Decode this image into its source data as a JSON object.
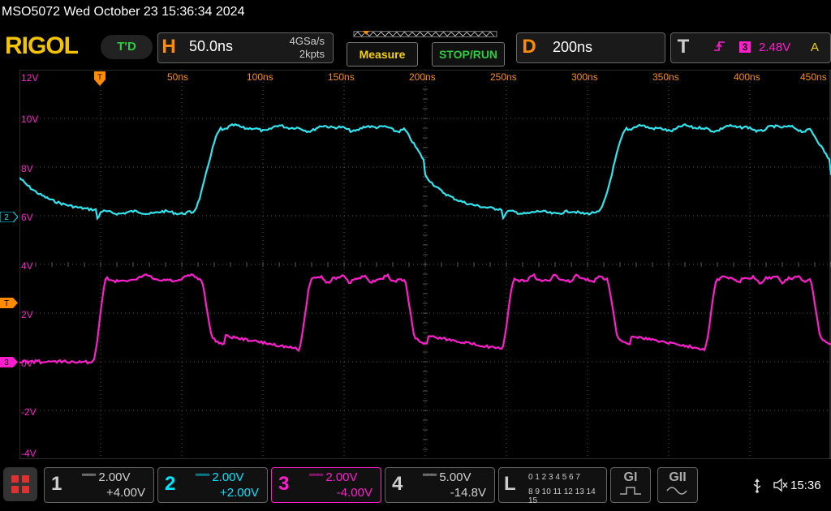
{
  "header": {
    "title": "MSO5072  Wed October 23 15:36:34 2024",
    "logo": "RIGOL",
    "td_badge": "T'D"
  },
  "horizontal": {
    "letter": "H",
    "timebase": "50.0ns",
    "sample_rate": "4GSa/s",
    "mem_depth": "2kpts"
  },
  "buttons": {
    "measure": "Measure",
    "stop_run": "STOP/RUN"
  },
  "delay": {
    "letter": "D",
    "value": "200ns"
  },
  "trigger": {
    "letter": "T",
    "source": "3",
    "level": "2.48V",
    "mode": "A"
  },
  "time_axis": [
    "50ns",
    "100ns",
    "150ns",
    "200ns",
    "250ns",
    "300ns",
    "350ns",
    "400ns",
    "450ns"
  ],
  "volt_axis": [
    "12V",
    "10V",
    "8V",
    "6V",
    "4V",
    "2V",
    "0V",
    "-2V",
    "-4V"
  ],
  "markers": {
    "ch2": "2",
    "trig": "T",
    "ch3": "3"
  },
  "channels": [
    {
      "num": "1",
      "scale": "2.00V",
      "offset": "+4.00V",
      "color": "#cfcfcf"
    },
    {
      "num": "2",
      "scale": "2.00V",
      "offset": "+2.00V",
      "color": "#00e5ff"
    },
    {
      "num": "3",
      "scale": "2.00V",
      "offset": "-4.00V",
      "color": "#ff1dce"
    },
    {
      "num": "4",
      "scale": "5.00V",
      "offset": "-14.8V",
      "color": "#cfcfcf"
    }
  ],
  "logic": {
    "letter": "L",
    "row1": "0 1 2 3  4 5 6 7",
    "row2": "8 9 10 11 12 13 14 15"
  },
  "gen_buttons": [
    "GI",
    "GII"
  ],
  "status": {
    "clock": "15:36"
  },
  "colors": {
    "ch2_trace": "#2fe6f0",
    "ch3_trace": "#ff1dce",
    "grid": "#555555",
    "label_orange": "#ff8c00"
  }
}
